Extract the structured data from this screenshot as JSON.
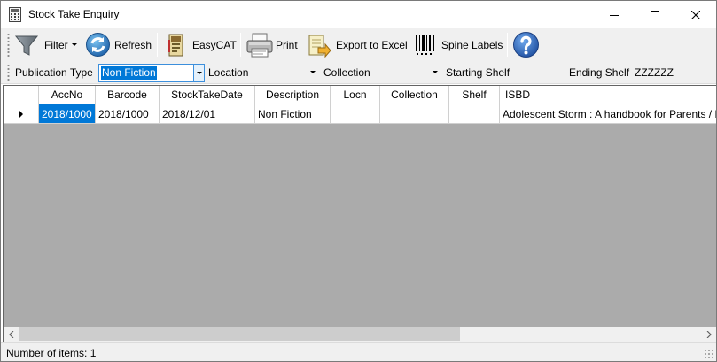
{
  "window": {
    "title": "Stock Take Enquiry",
    "app_icon": "calculator-icon"
  },
  "toolbar": {
    "filter_label": "Filter",
    "refresh_label": "Refresh",
    "easycat_label": "EasyCAT",
    "print_label": "Print",
    "export_label": "Export to Excel",
    "spine_labels_label": "Spine Labels",
    "help_icon": "help-icon"
  },
  "filters": {
    "publication_type_label": "Publication Type",
    "publication_type_value": "Non Fiction",
    "location_label": "Location",
    "location_value": "",
    "collection_label": "Collection",
    "collection_value": "",
    "starting_shelf_label": "Starting Shelf",
    "starting_shelf_value": "",
    "ending_shelf_label": "Ending Shelf",
    "ending_shelf_value": "ZZZZZZ"
  },
  "grid": {
    "columns": [
      "AccNo",
      "Barcode",
      "StockTakeDate",
      "Description",
      "Locn",
      "Collection",
      "Shelf",
      "ISBD"
    ],
    "rows": [
      {
        "accno": "2018/1000",
        "barcode": "2018/1000",
        "stocktakedate": "2018/12/01",
        "description": "Non Fiction",
        "locn": "",
        "collection": "",
        "shelf": "",
        "isbd": "Adolescent Storm : A handbook for Parents / Meg Bl"
      }
    ]
  },
  "status": {
    "items_text": "Number of items: 1"
  },
  "colors": {
    "selection": "#0078d7",
    "grid_background": "#ababab",
    "toolbar_background": "#f0f0f0"
  }
}
